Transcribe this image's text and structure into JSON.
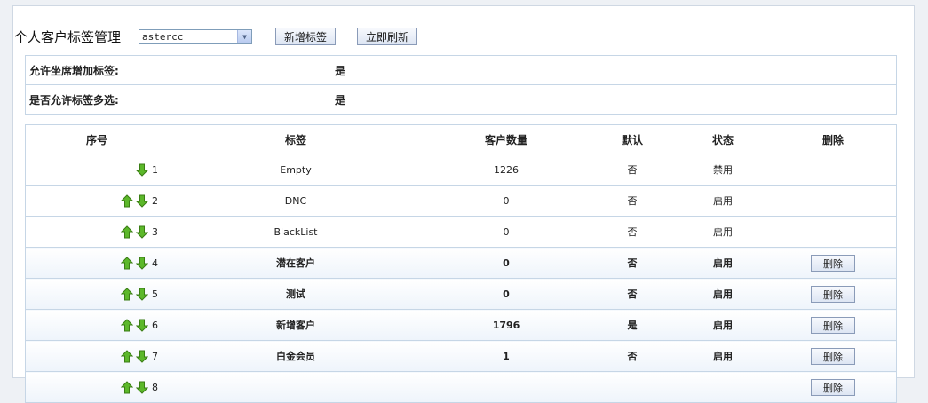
{
  "header": {
    "title": "个人客户标签管理",
    "select_value": "astercc",
    "add_button": "新增标签",
    "refresh_button": "立即刷新"
  },
  "settings": [
    {
      "label": "允许坐席增加标签:",
      "value": "是"
    },
    {
      "label": "是否允许标签多选:",
      "value": "是"
    }
  ],
  "table": {
    "headers": [
      "序号",
      "标签",
      "客户数量",
      "默认",
      "状态",
      "删除"
    ],
    "delete_label": "删除",
    "rows": [
      {
        "seq": "1",
        "tag": "Empty",
        "count": "1226",
        "default": "否",
        "status": "禁用",
        "deletable": false,
        "up": false
      },
      {
        "seq": "2",
        "tag": "DNC",
        "count": "0",
        "default": "否",
        "status": "启用",
        "deletable": false,
        "up": true
      },
      {
        "seq": "3",
        "tag": "BlackList",
        "count": "0",
        "default": "否",
        "status": "启用",
        "deletable": false,
        "up": true
      },
      {
        "seq": "4",
        "tag": "潜在客户",
        "count": "0",
        "default": "否",
        "status": "启用",
        "deletable": true,
        "up": true
      },
      {
        "seq": "5",
        "tag": "测试",
        "count": "0",
        "default": "否",
        "status": "启用",
        "deletable": true,
        "up": true
      },
      {
        "seq": "6",
        "tag": "新增客户",
        "count": "1796",
        "default": "是",
        "status": "启用",
        "deletable": true,
        "up": true
      },
      {
        "seq": "7",
        "tag": "白金会员",
        "count": "1",
        "default": "否",
        "status": "启用",
        "deletable": true,
        "up": true
      },
      {
        "seq": "8",
        "tag": "",
        "count": "",
        "default": "",
        "status": "",
        "deletable": true,
        "up": true
      }
    ]
  },
  "colors": {
    "arrow_green": "#5cb82a",
    "arrow_dark": "#3a7d14",
    "border": "#c6d6e6"
  }
}
